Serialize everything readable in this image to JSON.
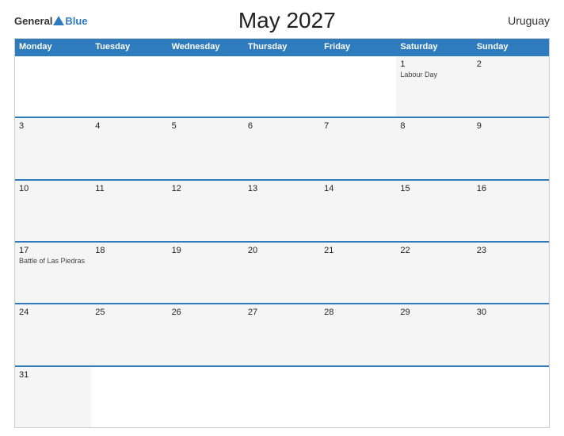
{
  "header": {
    "title": "May 2027",
    "country": "Uruguay",
    "logo_general": "General",
    "logo_blue": "Blue"
  },
  "day_headers": [
    "Monday",
    "Tuesday",
    "Wednesday",
    "Thursday",
    "Friday",
    "Saturday",
    "Sunday"
  ],
  "weeks": [
    [
      {
        "day": "",
        "holiday": "",
        "empty": true
      },
      {
        "day": "",
        "holiday": "",
        "empty": true
      },
      {
        "day": "",
        "holiday": "",
        "empty": true
      },
      {
        "day": "",
        "holiday": "",
        "empty": true
      },
      {
        "day": "",
        "holiday": "",
        "empty": true
      },
      {
        "day": "1",
        "holiday": "Labour Day",
        "empty": false
      },
      {
        "day": "2",
        "holiday": "",
        "empty": false
      }
    ],
    [
      {
        "day": "3",
        "holiday": "",
        "empty": false
      },
      {
        "day": "4",
        "holiday": "",
        "empty": false
      },
      {
        "day": "5",
        "holiday": "",
        "empty": false
      },
      {
        "day": "6",
        "holiday": "",
        "empty": false
      },
      {
        "day": "7",
        "holiday": "",
        "empty": false
      },
      {
        "day": "8",
        "holiday": "",
        "empty": false
      },
      {
        "day": "9",
        "holiday": "",
        "empty": false
      }
    ],
    [
      {
        "day": "10",
        "holiday": "",
        "empty": false
      },
      {
        "day": "11",
        "holiday": "",
        "empty": false
      },
      {
        "day": "12",
        "holiday": "",
        "empty": false
      },
      {
        "day": "13",
        "holiday": "",
        "empty": false
      },
      {
        "day": "14",
        "holiday": "",
        "empty": false
      },
      {
        "day": "15",
        "holiday": "",
        "empty": false
      },
      {
        "day": "16",
        "holiday": "",
        "empty": false
      }
    ],
    [
      {
        "day": "17",
        "holiday": "Battle of Las Piedras",
        "empty": false
      },
      {
        "day": "18",
        "holiday": "",
        "empty": false
      },
      {
        "day": "19",
        "holiday": "",
        "empty": false
      },
      {
        "day": "20",
        "holiday": "",
        "empty": false
      },
      {
        "day": "21",
        "holiday": "",
        "empty": false
      },
      {
        "day": "22",
        "holiday": "",
        "empty": false
      },
      {
        "day": "23",
        "holiday": "",
        "empty": false
      }
    ],
    [
      {
        "day": "24",
        "holiday": "",
        "empty": false
      },
      {
        "day": "25",
        "holiday": "",
        "empty": false
      },
      {
        "day": "26",
        "holiday": "",
        "empty": false
      },
      {
        "day": "27",
        "holiday": "",
        "empty": false
      },
      {
        "day": "28",
        "holiday": "",
        "empty": false
      },
      {
        "day": "29",
        "holiday": "",
        "empty": false
      },
      {
        "day": "30",
        "holiday": "",
        "empty": false
      }
    ],
    [
      {
        "day": "31",
        "holiday": "",
        "empty": false
      },
      {
        "day": "",
        "holiday": "",
        "empty": true
      },
      {
        "day": "",
        "holiday": "",
        "empty": true
      },
      {
        "day": "",
        "holiday": "",
        "empty": true
      },
      {
        "day": "",
        "holiday": "",
        "empty": true
      },
      {
        "day": "",
        "holiday": "",
        "empty": true
      },
      {
        "day": "",
        "holiday": "",
        "empty": true
      }
    ]
  ]
}
